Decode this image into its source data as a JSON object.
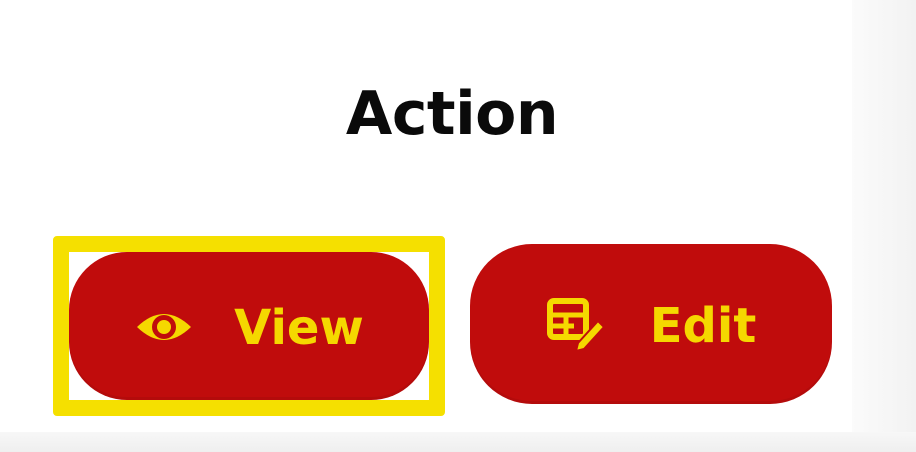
{
  "section": {
    "title": "Action"
  },
  "actions": {
    "view_label": "View",
    "edit_label": "Edit",
    "view_icon": "eye-icon",
    "edit_icon": "table-edit-icon"
  },
  "colors": {
    "button_bg": "#c00c0c",
    "button_fg": "#f5d800",
    "focus_outline": "#f5e000"
  }
}
